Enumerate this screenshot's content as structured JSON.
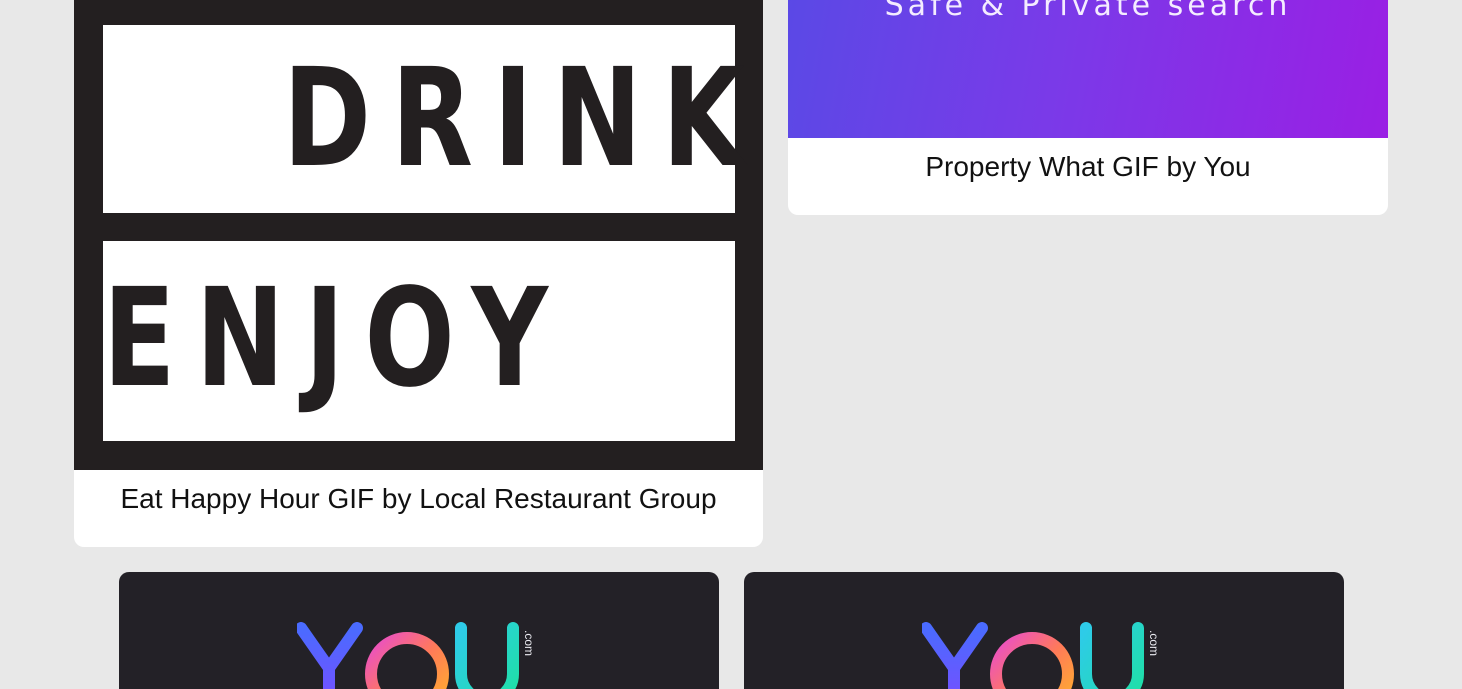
{
  "cards": [
    {
      "caption": "Eat Happy Hour GIF by Local Restaurant Group",
      "gif_words": [
        "DRINK",
        "ENJOY"
      ]
    },
    {
      "caption": "Property What GIF by You",
      "gif_text": "Safe & Private search"
    }
  ],
  "you_cards": [
    {
      "logo_text": "YOU",
      "logo_suffix": ".com"
    },
    {
      "logo_text": "YOU",
      "logo_suffix": ".com"
    }
  ],
  "colors": {
    "background": "#e8e8e8",
    "card": "#ffffff",
    "dark_gif": "#231f20",
    "you_card": "#232127",
    "gradient_start": "#5a49e6",
    "gradient_end": "#9a1fe4"
  }
}
